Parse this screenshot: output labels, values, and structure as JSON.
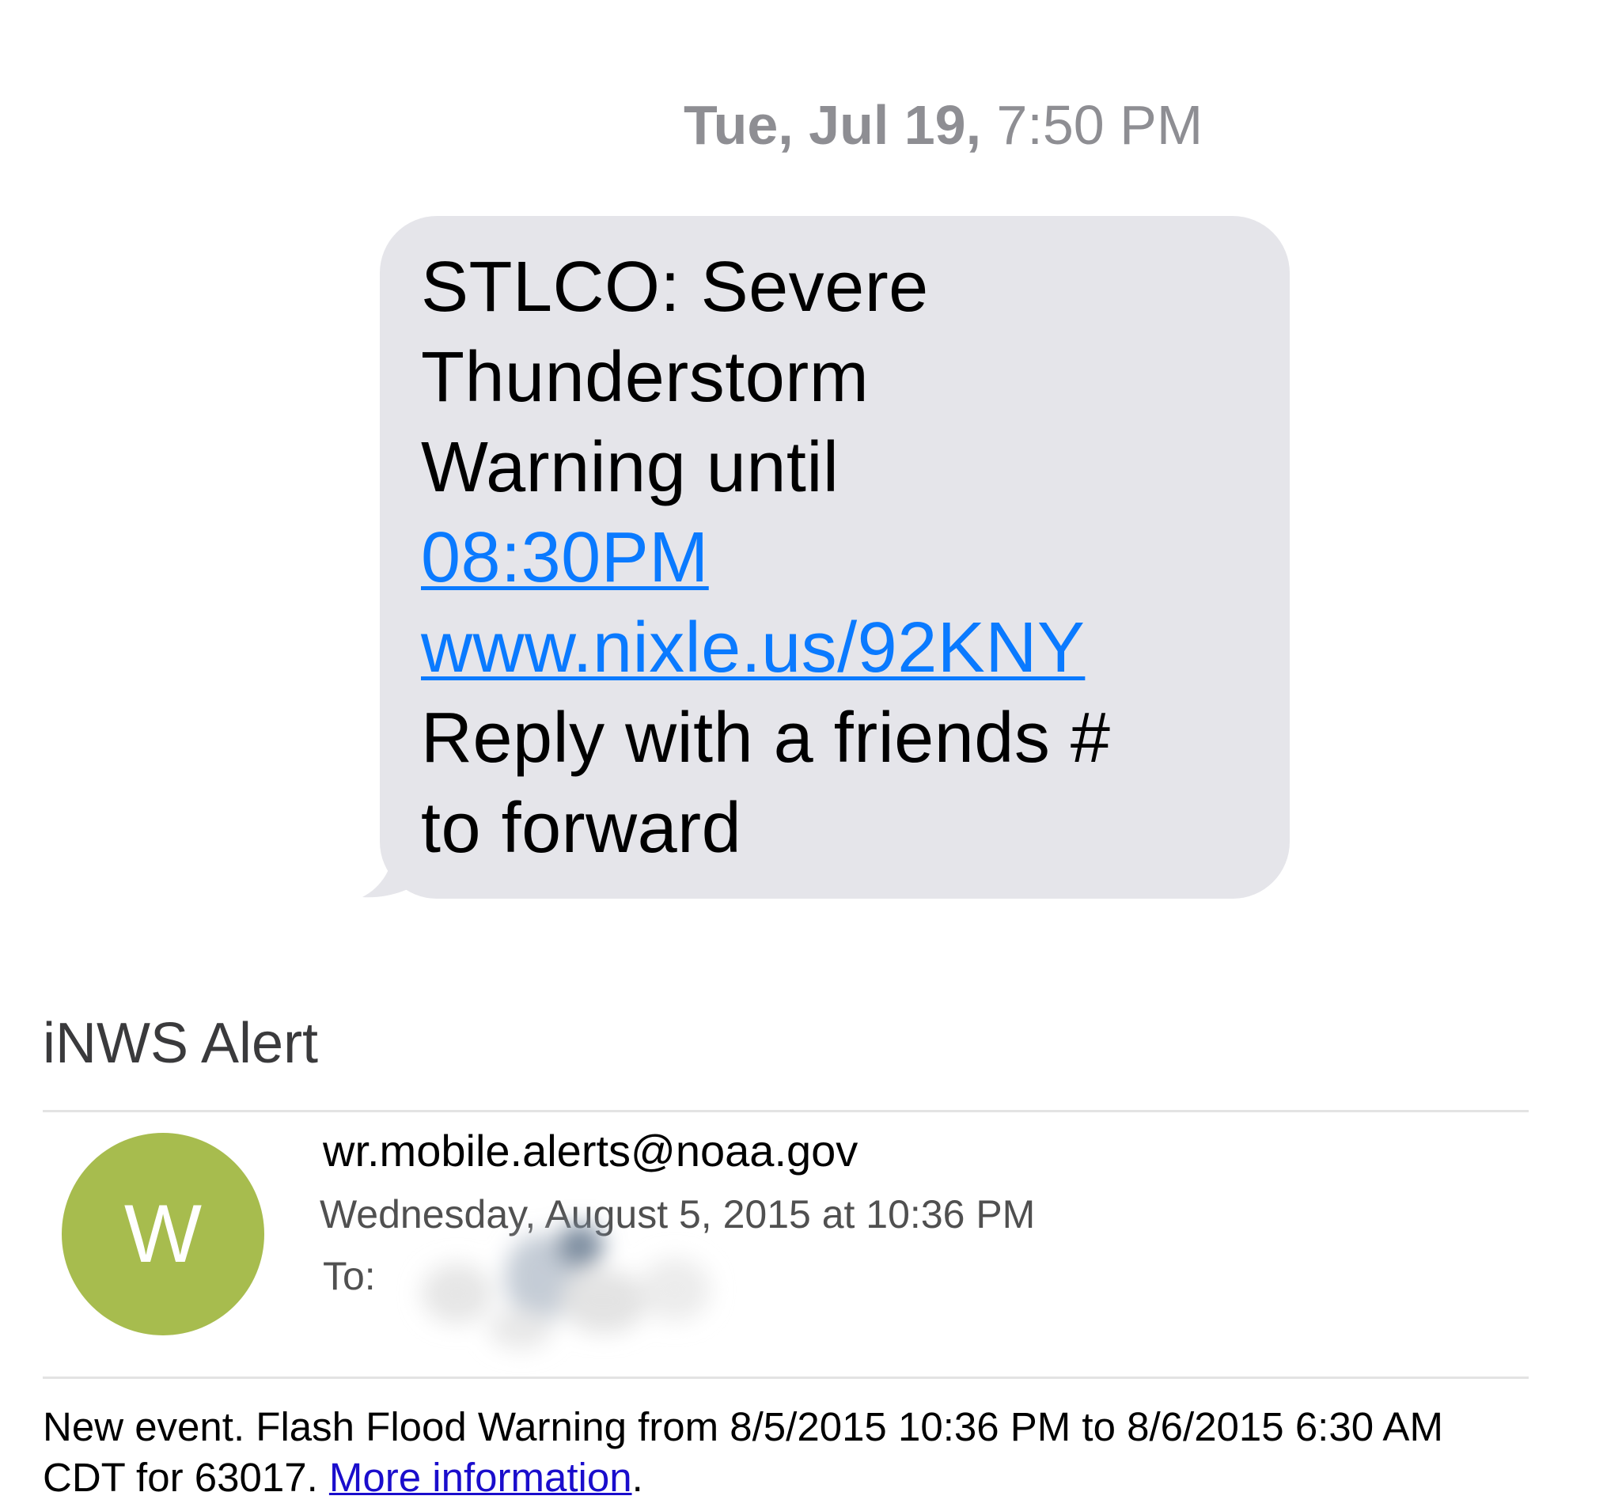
{
  "imessage": {
    "timestamp_day": "Tue, Jul 19,",
    "timestamp_time": " 7:50 PM",
    "bubble_lines": {
      "l1": "STLCO: Severe",
      "l2": "Thunderstorm",
      "l3": "Warning until",
      "l4_link": "08:30PM",
      "l5_link": "www.nixle.us/92KNY",
      "l6": "Reply with a friends #",
      "l7": "to forward"
    },
    "colors": {
      "bubble_bg": "#e5e5ea",
      "link": "#0a7aff",
      "timestamp": "#8e8e93"
    }
  },
  "email": {
    "subject": "iNWS Alert",
    "avatar_letter": "W",
    "avatar_color": "#a7bc4e",
    "sender": "wr.mobile.alerts@noaa.gov",
    "date": "Wednesday, August 5, 2015 at 10:36 PM",
    "to_label": "To:",
    "body_line1": "New event. Flash Flood Warning from 8/5/2015 10:36 PM to 8/6/2015 6:30 AM",
    "body_line2_prefix": "CDT for 63017. ",
    "body_link": "More information",
    "body_line2_suffix": ".",
    "link_color": "#1a0dcc"
  }
}
